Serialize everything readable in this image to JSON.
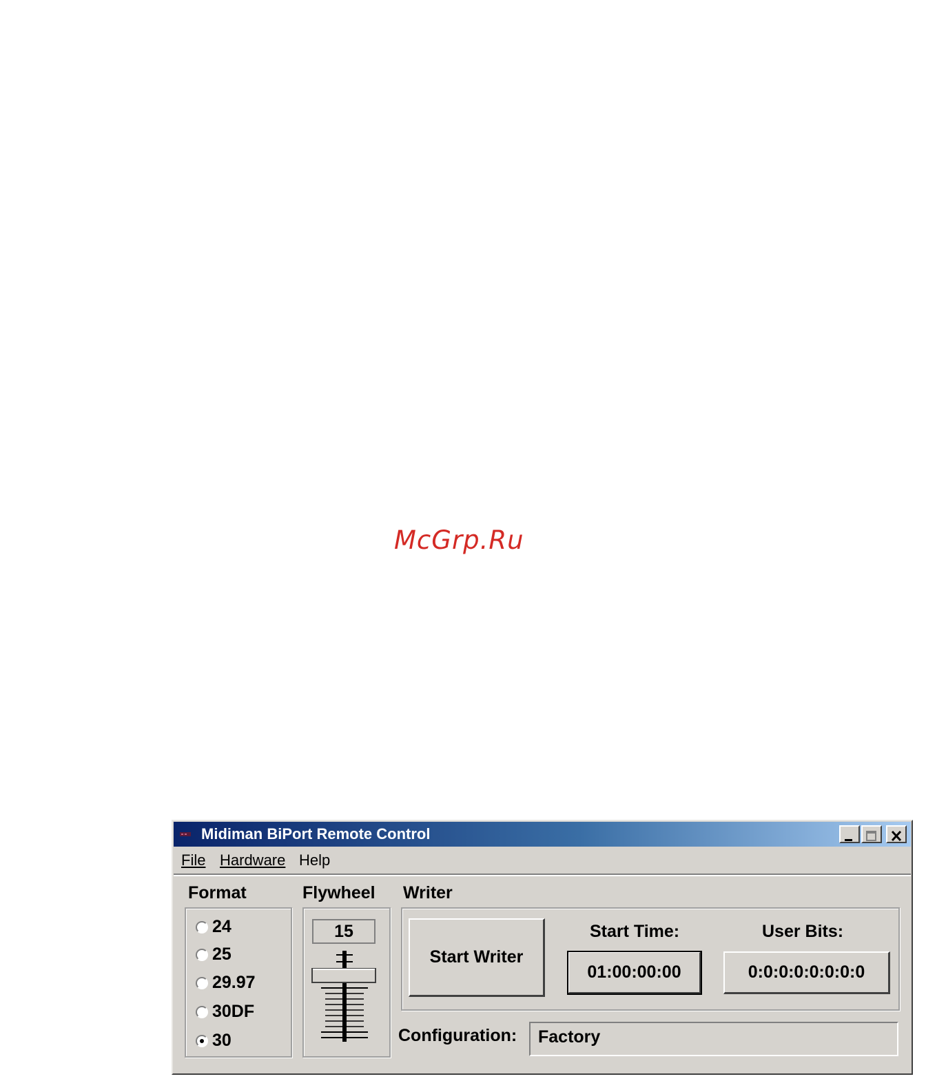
{
  "watermark": "McGrp.Ru",
  "window": {
    "title": "Midiman BiPort Remote Control",
    "controls": {
      "minimize": "minimize-icon",
      "maximize": "maximize-icon",
      "close": "close-icon"
    }
  },
  "menu": {
    "file": "File",
    "hardware": "Hardware",
    "help": "Help"
  },
  "format": {
    "label": "Format",
    "options": [
      "24",
      "25",
      "29.97",
      "30DF",
      "30"
    ],
    "selected": "30"
  },
  "flywheel": {
    "label": "Flywheel",
    "value": "15"
  },
  "writer": {
    "label": "Writer",
    "start_button": "Start Writer",
    "start_time_label": "Start Time:",
    "start_time_value": "01:00:00:00",
    "user_bits_label": "User Bits:",
    "user_bits_value": "0:0:0:0:0:0:0:0"
  },
  "configuration": {
    "label": "Configuration:",
    "value": "Factory"
  }
}
